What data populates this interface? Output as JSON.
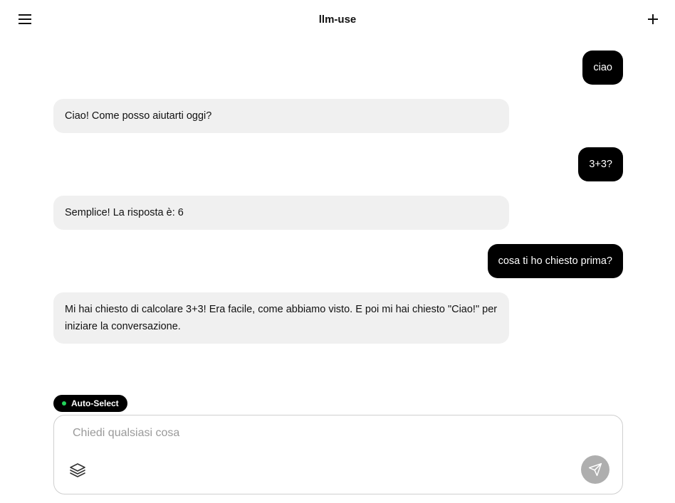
{
  "header": {
    "title": "llm-use",
    "menu_icon": "hamburger-menu-icon",
    "new_chat_icon": "plus-icon"
  },
  "messages": [
    {
      "role": "user",
      "text": "ciao"
    },
    {
      "role": "assistant",
      "text": "Ciao! Come posso aiutarti oggi?"
    },
    {
      "role": "user",
      "text": "3+3?"
    },
    {
      "role": "assistant",
      "text": "Semplice! La risposta è: 6"
    },
    {
      "role": "user",
      "text": "cosa ti ho chiesto prima?"
    },
    {
      "role": "assistant",
      "text": "Mi hai chiesto di calcolare 3+3! Era facile, come abbiamo visto. E poi mi hai chiesto \"Ciao!\" per iniziare la conversazione."
    }
  ],
  "model_selector": {
    "label": "Auto-Select",
    "status_color": "#22d35a"
  },
  "composer": {
    "placeholder": "Chiedi qualsiasi cosa",
    "value": "",
    "layers_icon": "layers-icon",
    "send_icon": "send-icon"
  },
  "colors": {
    "user_bubble": "#000000",
    "assistant_bubble": "#f0f0f0",
    "send_button_disabled": "#aeaeae"
  }
}
